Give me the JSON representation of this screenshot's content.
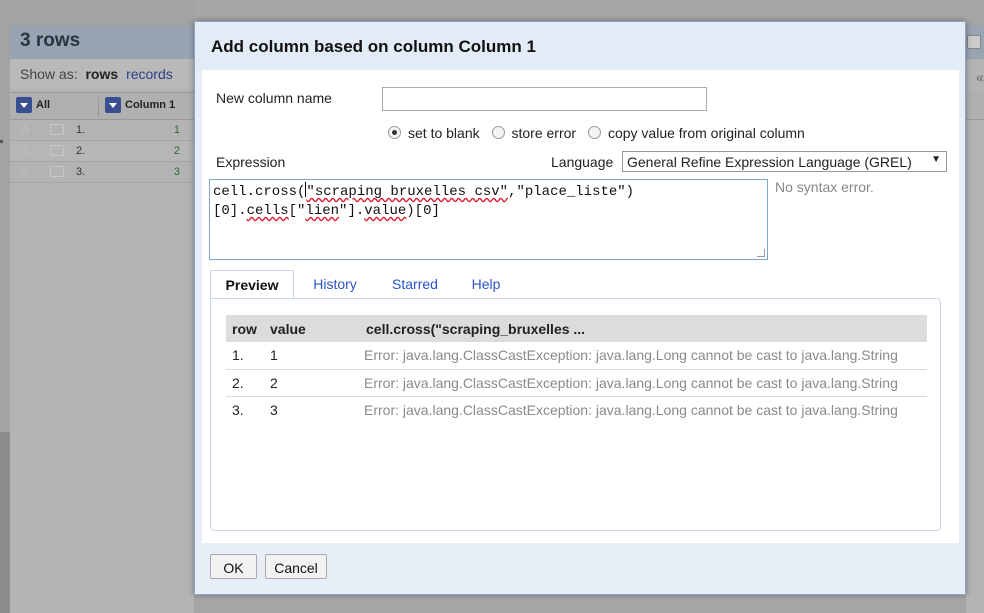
{
  "background": {
    "row_count": "3 rows",
    "show_as_label": "Show as:",
    "show_as_rows": "rows",
    "show_as_records": "records",
    "header_all": "All",
    "header_column": "Column 1",
    "rows": [
      {
        "num": "1.",
        "value": "1"
      },
      {
        "num": "2.",
        "value": "2"
      },
      {
        "num": "3.",
        "value": "3"
      }
    ]
  },
  "dialog": {
    "title": "Add column based on column Column 1",
    "new_column_name_label": "New column name",
    "new_column_name_value": "",
    "on_error_options": [
      {
        "label": "set to blank",
        "selected": true
      },
      {
        "label": "store error",
        "selected": false
      },
      {
        "label": "copy value from original column",
        "selected": false
      }
    ],
    "expression_label": "Expression",
    "language_label": "Language",
    "language_value": "General Refine Expression Language (GREL)",
    "expression_line1_prefix": "cell.cross(",
    "expression_line1_str": "\"scraping bruxelles csv\"",
    "expression_line1_suffix": ",\"place_liste\")",
    "expression_line2_a": "[0].",
    "expression_line2_b": "cells",
    "expression_line2_c": "[\"",
    "expression_line2_d": "lien",
    "expression_line2_e": "\"].",
    "expression_line2_f": "value",
    "expression_line2_g": ")[0]",
    "syntax_status": "No syntax error.",
    "tabs": [
      "Preview",
      "History",
      "Starred",
      "Help"
    ],
    "preview": {
      "headers": [
        "row",
        "value",
        "cell.cross(\"scraping_bruxelles ..."
      ],
      "rows": [
        {
          "row": "1.",
          "value": "1",
          "result": "Error: java.lang.ClassCastException: java.lang.Long cannot be cast to java.lang.String"
        },
        {
          "row": "2.",
          "value": "2",
          "result": "Error: java.lang.ClassCastException: java.lang.Long cannot be cast to java.lang.String"
        },
        {
          "row": "3.",
          "value": "3",
          "result": "Error: java.lang.ClassCastException: java.lang.Long cannot be cast to java.lang.String"
        }
      ]
    },
    "ok_label": "OK",
    "cancel_label": "Cancel"
  }
}
